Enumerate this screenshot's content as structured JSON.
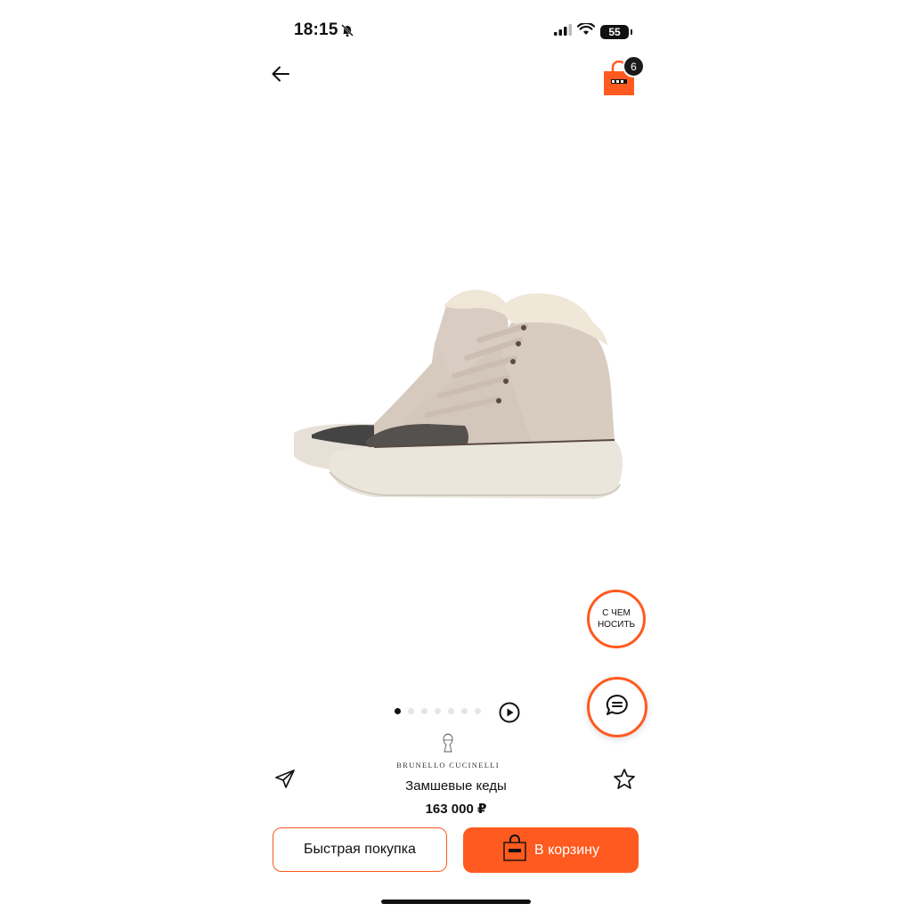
{
  "status_bar": {
    "time": "18:15",
    "battery": "55"
  },
  "header": {
    "cart_count": "6"
  },
  "carousel": {
    "total": 7,
    "active_index": 0
  },
  "outfit_button": {
    "line1": "С ЧЕМ",
    "line2": "НОСИТЬ"
  },
  "product": {
    "brand": "BRUNELLO CUCINELLI",
    "title": "Замшевые кеды",
    "price": "163 000 ₽"
  },
  "actions": {
    "quick_buy": "Быстрая покупка",
    "add_to_cart": "В корзину"
  },
  "colors": {
    "accent": "#ff5a1f"
  }
}
